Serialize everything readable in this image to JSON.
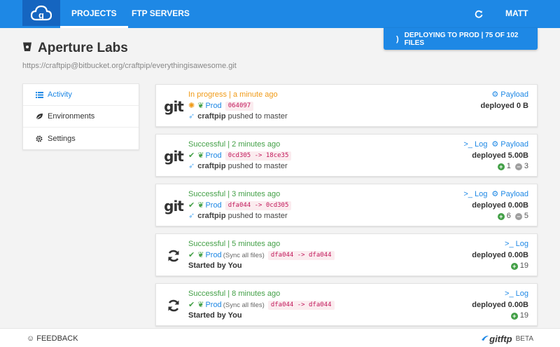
{
  "nav": {
    "logo_icon": "gitftp-cloud-logo",
    "tabs": [
      {
        "label": "PROJECTS",
        "active": true
      },
      {
        "label": "FTP SERVERS",
        "active": false
      }
    ],
    "refresh_icon": "refresh-icon",
    "user": "MATT"
  },
  "banner": {
    "text": "DEPLOYING TO PROD | 75 OF 102 FILES",
    "spinner_icon": "spinner-icon",
    "progress": {
      "done": 75,
      "total": 102
    }
  },
  "project": {
    "title": "Aperture Labs",
    "icon": "bitbucket-icon",
    "url": "https://craftpip@bitbucket.org/craftpip/everythingisawesome.git"
  },
  "sidemenu": [
    {
      "label": "Activity",
      "icon": "list-icon",
      "active": true
    },
    {
      "label": "Environments",
      "icon": "leaf-icon",
      "active": false
    },
    {
      "label": "Settings",
      "icon": "gear-icon",
      "active": false
    }
  ],
  "activities": [
    {
      "source": "git",
      "status": "In progress | a minute ago",
      "state": "progress",
      "env": "Prod",
      "sync": "",
      "commit": "064097",
      "pusher": "craftpip",
      "action": "pushed to master",
      "started_by": "",
      "links": [
        "Payload"
      ],
      "deployed": "deployed 0 B",
      "added": "",
      "removed": ""
    },
    {
      "source": "git",
      "status": "Successful | 2 minutes ago",
      "state": "success",
      "env": "Prod",
      "sync": "",
      "commit": "0cd305 -> 18ce35",
      "pusher": "craftpip",
      "action": "pushed to master",
      "started_by": "",
      "links": [
        "Log",
        "Payload"
      ],
      "deployed": "deployed 5.00B",
      "added": "1",
      "removed": "3"
    },
    {
      "source": "git",
      "status": "Successful | 3 minutes ago",
      "state": "success",
      "env": "Prod",
      "sync": "",
      "commit": "dfa044 -> 0cd305",
      "pusher": "craftpip",
      "action": "pushed to master",
      "started_by": "",
      "links": [
        "Log",
        "Payload"
      ],
      "deployed": "deployed 0.00B",
      "added": "6",
      "removed": "5"
    },
    {
      "source": "sync",
      "status": "Successful | 5 minutes ago",
      "state": "success",
      "env": "Prod",
      "sync": "(Sync all files)",
      "commit": "dfa044 -> dfa044",
      "pusher": "",
      "action": "",
      "started_by": "Started by You",
      "links": [
        "Log"
      ],
      "deployed": "deployed 0.00B",
      "added": "19",
      "removed": ""
    },
    {
      "source": "sync",
      "status": "Successful | 8 minutes ago",
      "state": "success",
      "env": "Prod",
      "sync": "(Sync all files)",
      "commit": "dfa044 -> dfa044",
      "pusher": "",
      "action": "",
      "started_by": "Started by You",
      "links": [
        "Log"
      ],
      "deployed": "deployed 0.00B",
      "added": "19",
      "removed": ""
    }
  ],
  "footer": {
    "feedback": "FEEDBACK",
    "feedback_icon": "smile-icon",
    "brand": "gitftp",
    "beta": "BETA"
  },
  "colors": {
    "primary": "#1e88e5",
    "success": "#43a047",
    "progress": "#f09a16",
    "commit": "#c2185b"
  }
}
